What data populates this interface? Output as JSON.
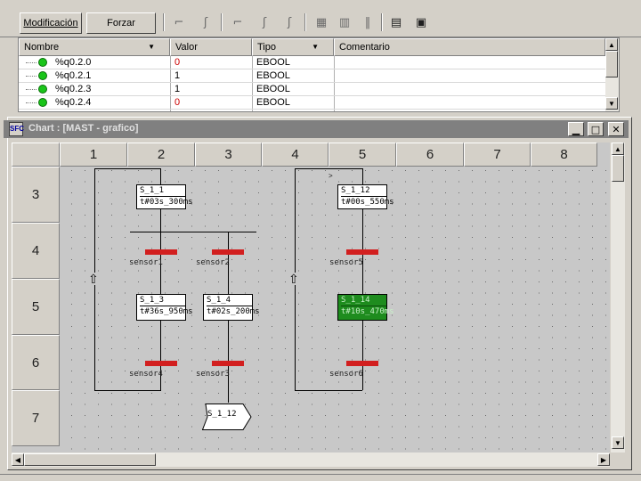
{
  "toolbar": {
    "modify_label": "Modificación",
    "force_label": "Forzar"
  },
  "vartable": {
    "columns": [
      "Nombre",
      "Valor",
      "Tipo",
      "Comentario"
    ],
    "rows": [
      {
        "name": "%q0.2.0",
        "value": "0",
        "type": "EBOOL",
        "comment": ""
      },
      {
        "name": "%q0.2.1",
        "value": "1",
        "type": "EBOOL",
        "comment": ""
      },
      {
        "name": "%q0.2.3",
        "value": "1",
        "type": "EBOOL",
        "comment": ""
      },
      {
        "name": "%q0.2.4",
        "value": "0",
        "type": "EBOOL",
        "comment": ""
      }
    ],
    "value_colors": {
      "zero": "#cc0000",
      "one": "#000000"
    }
  },
  "chart_window": {
    "title": "Chart : [MAST - grafico]",
    "col_headers": [
      "1",
      "2",
      "3",
      "4",
      "5",
      "6",
      "7",
      "8"
    ],
    "row_headers": [
      "3",
      "4",
      "5",
      "6",
      "7"
    ]
  },
  "sfc": {
    "steps": [
      {
        "name": "S_1_1",
        "time": "t#03s_300ms",
        "active": false
      },
      {
        "name": "S_1_3",
        "time": "t#36s_950ms",
        "active": false
      },
      {
        "name": "S_1_4",
        "time": "t#02s_200ms",
        "active": false
      },
      {
        "name": "S_1_12",
        "time": "t#00s_550ms",
        "active": false
      },
      {
        "name": "S_1_14",
        "time": "t#10s_470ms",
        "active": true
      }
    ],
    "transitions": [
      "sensor1",
      "sensor2",
      "sensor5",
      "sensor4",
      "sensor3",
      "sensor6"
    ],
    "jump_target": "S_1_12",
    "active_color": "#1e8c1e",
    "transition_color": "#d21f1f"
  }
}
